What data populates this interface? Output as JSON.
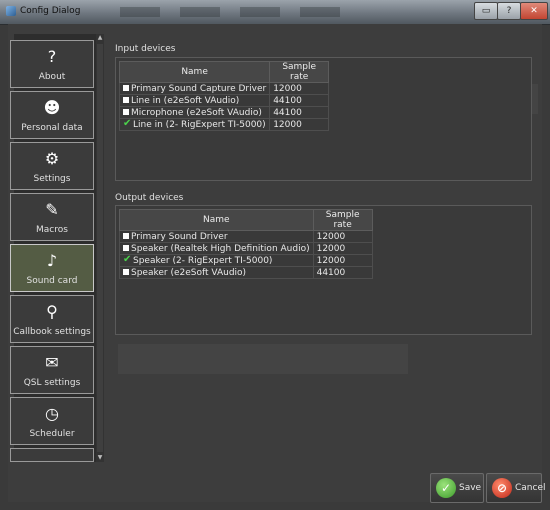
{
  "window": {
    "title": "Config Dialog",
    "close_glyph": "✕",
    "help_glyph": "?",
    "minimize_glyph": "▭"
  },
  "sidebar": {
    "items": [
      {
        "label": "About",
        "icon": "?",
        "icon_name": "question-icon"
      },
      {
        "label": "Personal data",
        "icon": "☻",
        "icon_name": "user-icon"
      },
      {
        "label": "Settings",
        "icon": "⚙",
        "icon_name": "gear-icon"
      },
      {
        "label": "Macros",
        "icon": "✎",
        "icon_name": "macro-icon"
      },
      {
        "label": "Sound card",
        "icon": "♪",
        "icon_name": "sound-card-icon",
        "active": true
      },
      {
        "label": "Callbook settings",
        "icon": "⚲",
        "icon_name": "callbook-icon"
      },
      {
        "label": "QSL settings",
        "icon": "✉",
        "icon_name": "qsl-card-icon"
      },
      {
        "label": "Scheduler",
        "icon": "◷",
        "icon_name": "scheduler-icon"
      }
    ]
  },
  "input_devices": {
    "title": "Input devices",
    "columns": [
      "Name",
      "Sample rate"
    ],
    "rows": [
      {
        "name": "Primary Sound Capture Driver",
        "rate": "12000",
        "checked": false
      },
      {
        "name": "Line in (e2eSoft VAudio)",
        "rate": "44100",
        "checked": false
      },
      {
        "name": "Microphone (e2eSoft VAudio)",
        "rate": "44100",
        "checked": false
      },
      {
        "name": "Line in (2- RigExpert TI-5000)",
        "rate": "12000",
        "checked": true
      }
    ]
  },
  "output_devices": {
    "title": "Output devices",
    "columns": [
      "Name",
      "Sample rate"
    ],
    "rows": [
      {
        "name": "Primary Sound Driver",
        "rate": "12000",
        "checked": false
      },
      {
        "name": "Speaker (Realtek High Definition Audio)",
        "rate": "12000",
        "checked": false
      },
      {
        "name": "Speaker (2- RigExpert TI-5000)",
        "rate": "12000",
        "checked": true
      },
      {
        "name": "Speaker (e2eSoft VAudio)",
        "rate": "44100",
        "checked": false
      }
    ]
  },
  "buttons": {
    "save": "Save",
    "cancel": "Cancel"
  },
  "colors": {
    "check": "#4bd14b",
    "save_icon": "#3c9b2a",
    "cancel_icon": "#c0281a"
  }
}
